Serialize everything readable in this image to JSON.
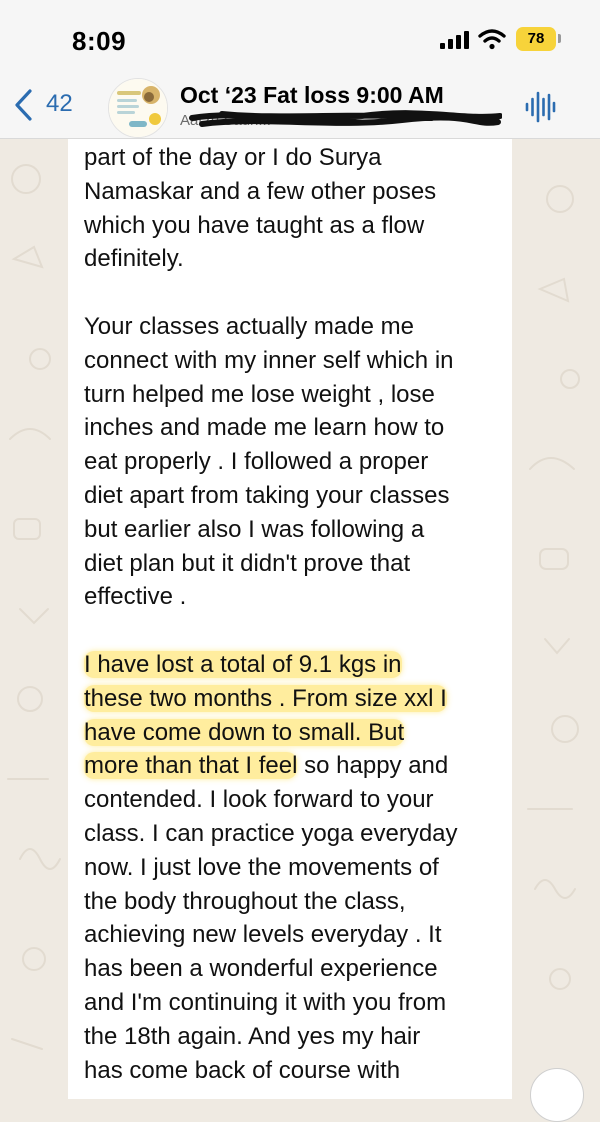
{
  "status_bar": {
    "time": "8:09",
    "battery": "78",
    "battery_color": "#f7d33a"
  },
  "header": {
    "back_count": "42",
    "title": "Oct ‘23 Fat loss 9:00 AM",
    "subtitle": "Aarzu Sadh...",
    "back_icon": "chevron-left-icon",
    "voice_icon": "voice-waveform-icon",
    "accent_color": "#2b6cb0"
  },
  "message": {
    "paragraphs": [
      {
        "segments": [
          {
            "text": "part of the day or I do Surya\nNamaskar and a few other poses\nwhich you have taught as a flow\ndefinitely.",
            "highlight": false
          }
        ]
      },
      {
        "segments": [
          {
            "text": "Your classes actually made me\nconnect with my inner self which in\nturn helped me lose weight , lose\ninches and made me learn how to\neat properly . I followed a proper\ndiet apart from taking your classes\nbut earlier also I was following a\ndiet plan but it didn't prove that\neffective .",
            "highlight": false
          }
        ]
      },
      {
        "segments": [
          {
            "text": "I have lost a total of 9.1 kgs in\nthese two months . From size xxl I\nhave come down to small. But\nmore than that I feel",
            "highlight": true
          },
          {
            "text": " so happy and\ncontended. I look forward to your\nclass. I can practice yoga everyday\nnow. I just love the movements of\nthe body throughout the class,\nachieving new levels everyday . It\nhas been a wonderful experience\nand I'm continuing it with you from\nthe 18th again. And yes my hair\nhas come back of course with",
            "highlight": false
          }
        ]
      }
    ],
    "highlight_color": "#ffd628"
  }
}
